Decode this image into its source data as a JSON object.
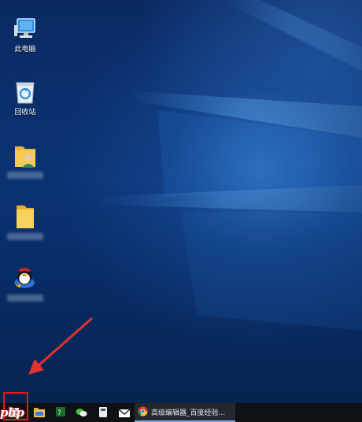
{
  "desktop": {
    "icons": [
      {
        "label": "此电脑",
        "icon": "computer-icon"
      },
      {
        "label": "回收站",
        "icon": "recycle-bin-icon"
      },
      {
        "label": "",
        "icon": "user-folder-icon"
      },
      {
        "label": "",
        "icon": "folder-icon"
      },
      {
        "label": "",
        "icon": "qq-penguin-icon"
      }
    ]
  },
  "annotation": {
    "color": "#e0322f"
  },
  "taskbar": {
    "icons": [
      "start-icon",
      "file-explorer-icon",
      "app-icon",
      "wechat-icon",
      "calculator-icon",
      "mail-icon",
      "chrome-icon"
    ],
    "active_window_title": "高级编辑器_百度经验...",
    "background": "#0e1116"
  },
  "watermark": {
    "text": "php"
  }
}
